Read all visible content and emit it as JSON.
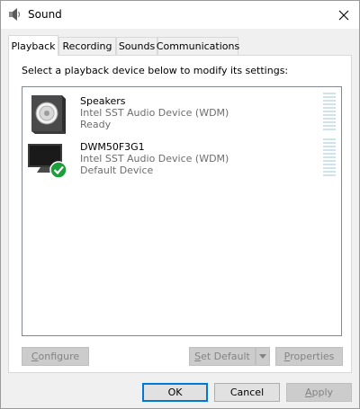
{
  "window": {
    "title": "Sound"
  },
  "tabs": [
    {
      "label": "Playback",
      "active": true
    },
    {
      "label": "Recording",
      "active": false
    },
    {
      "label": "Sounds",
      "active": false
    },
    {
      "label": "Communications",
      "active": false
    }
  ],
  "playback": {
    "instruction": "Select a playback device below to modify its settings:",
    "devices": [
      {
        "name": "Speakers",
        "driver": "Intel SST Audio Device (WDM)",
        "status": "Ready",
        "icon": "speaker-icon"
      },
      {
        "name": "DWM50F3G1",
        "driver": "Intel SST Audio Device (WDM)",
        "status": "Default Device",
        "icon": "monitor-icon",
        "is_default": true
      }
    ]
  },
  "buttons": {
    "configure": {
      "mnemonic": "C",
      "rest": "onfigure"
    },
    "set_default": {
      "mnemonic": "S",
      "rest": "et Default"
    },
    "properties": {
      "mnemonic": "P",
      "rest": "roperties"
    },
    "ok": "OK",
    "cancel": "Cancel",
    "apply": {
      "mnemonic": "A",
      "rest": "pply"
    }
  },
  "colors": {
    "accent": "#0078d7",
    "check_green": "#1e9e3a",
    "meter": "#cfe3ea"
  }
}
